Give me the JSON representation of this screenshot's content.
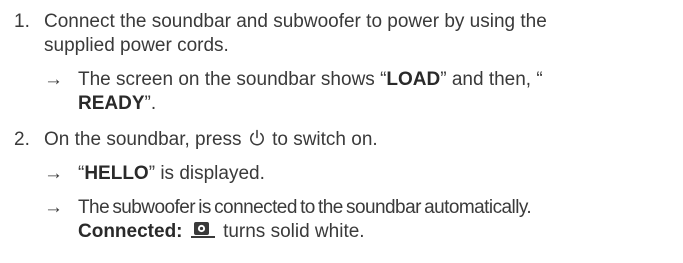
{
  "steps": [
    {
      "number": "1.",
      "line1": "Connect the soundbar and subwoofer to power by using the",
      "line2": "supplied power cords.",
      "results": [
        {
          "arrow": "→",
          "t1": "The screen on the soundbar shows “",
          "b1": "LOAD",
          "t2": "” and then, “",
          "b2": "READY",
          "t3": "”."
        }
      ]
    },
    {
      "number": "2.",
      "line1_before": "On the soundbar, press",
      "line1_icon": "power-icon",
      "line1_after": "to switch on.",
      "results": [
        {
          "arrow": "→",
          "q_open": "“",
          "b1": "HELLO",
          "t1": "” is displayed."
        },
        {
          "arrow": "→",
          "line1": "The subwoofer is connected to the soundbar automatically.",
          "b1": "Connected:",
          "icon": "subwoofer-connection-icon",
          "t1": "turns solid white."
        }
      ]
    }
  ]
}
